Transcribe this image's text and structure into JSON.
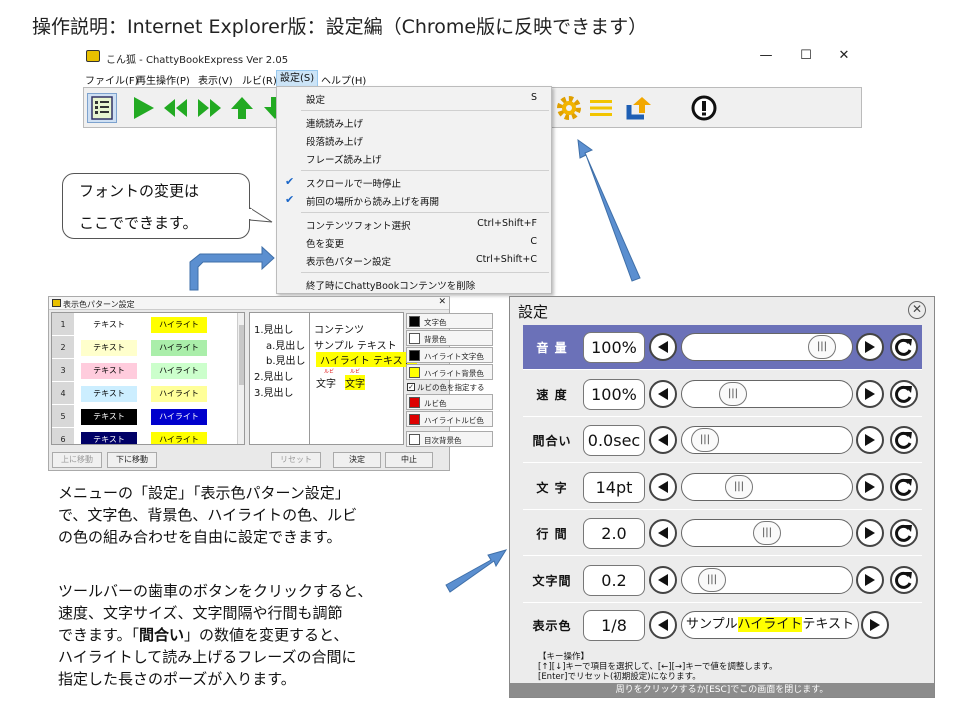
{
  "slide_title": "操作説明：Internet  Explorer版：設定編（Chrome版に反映できます）",
  "window": {
    "title": "こん狐 - ChattyBookExpress Ver 2.05",
    "controls": [
      "—",
      "☐",
      "✕"
    ],
    "menu": [
      "ファイル(F)",
      "再生操作(P)",
      "表示(V)",
      "ルビ(R)",
      "設定(S)",
      "ヘルプ(H)"
    ],
    "active_menu_index": 4
  },
  "toolbar_icons": [
    "list-icon",
    "play-icon",
    "rewind-icon",
    "fast-forward-icon",
    "up-arrow-icon",
    "down-arrow-icon",
    "gear-icon",
    "menu-lines-icon",
    "update-icon",
    "info-icon"
  ],
  "dropdown": {
    "items": [
      {
        "label": "設定",
        "key": "S",
        "checked": false
      },
      {
        "label": "連続読み上げ",
        "key": "",
        "checked": false
      },
      {
        "label": "段落読み上げ",
        "key": "",
        "checked": false
      },
      {
        "label": "フレーズ読み上げ",
        "key": "",
        "checked": false
      },
      {
        "label": "スクロールで一時停止",
        "key": "",
        "checked": true
      },
      {
        "label": "前回の場所から読み上げを再開",
        "key": "",
        "checked": true
      },
      {
        "label": "コンテンツフォント選択",
        "key": "Ctrl+Shift+F",
        "checked": false
      },
      {
        "label": "色を変更",
        "key": "C",
        "checked": false
      },
      {
        "label": "表示色パターン設定",
        "key": "Ctrl+Shift+C",
        "checked": false
      },
      {
        "label": "終了時にChattyBookコンテンツを削除",
        "key": "",
        "checked": false
      }
    ]
  },
  "callout": {
    "line1": "フォントの変更は",
    "line2": "ここでできます。"
  },
  "pattern_dialog": {
    "title": "表示色パターン設定",
    "close": "✕",
    "rows": [
      {
        "num": "1",
        "text": "テキスト",
        "highlight": "ハイライト",
        "text_bg": "#ffffff",
        "text_fg": "#000000",
        "hl_bg": "#ffff00",
        "hl_fg": "#000000"
      },
      {
        "num": "2",
        "text": "テキスト",
        "highlight": "ハイライト",
        "text_bg": "#ffffcc",
        "text_fg": "#000000",
        "hl_bg": "#aaeeaa",
        "hl_fg": "#000000"
      },
      {
        "num": "3",
        "text": "テキスト",
        "highlight": "ハイライト",
        "text_bg": "#ffccdd",
        "text_fg": "#000000",
        "hl_bg": "#ccffcc",
        "hl_fg": "#000000"
      },
      {
        "num": "4",
        "text": "テキスト",
        "highlight": "ハイライト",
        "text_bg": "#cceeff",
        "text_fg": "#000000",
        "hl_bg": "#ffff99",
        "hl_fg": "#000000"
      },
      {
        "num": "5",
        "text": "テキスト",
        "highlight": "ハイライト",
        "text_bg": "#000000",
        "text_fg": "#ffffff",
        "hl_bg": "#0000cc",
        "hl_fg": "#ffffff"
      },
      {
        "num": "6",
        "text": "テキスト",
        "highlight": "ハイライト",
        "text_bg": "#000066",
        "text_fg": "#ffffff",
        "hl_bg": "#ffff00",
        "hl_fg": "#000000"
      }
    ],
    "outline": [
      "1.見出し",
      "a.見出し",
      "b.見出し",
      "2.見出し",
      "3.見出し"
    ],
    "content": {
      "line1": "コンテンツ",
      "line2": "サンプル テキスト",
      "highlight": "ハイライト テキスト",
      "ruby_base": "文字",
      "ruby_top": "ルビ",
      "ruby_base2": "文字",
      "ruby_top2": "ルビ"
    },
    "swatches": [
      {
        "label": "文字色",
        "color": "#000000"
      },
      {
        "label": "背景色",
        "color": "#ffffff"
      },
      {
        "label": "ハイライト文字色",
        "color": "#000000"
      },
      {
        "label": "ハイライト背景色",
        "color": "#ffff00"
      },
      {
        "label": "ルビの色を指定する",
        "color": "checkbox"
      },
      {
        "label": "ルビ色",
        "color": "#dd0000"
      },
      {
        "label": "ハイライトルビ色",
        "color": "#dd0000"
      },
      {
        "label": "目次背景色",
        "color": "#ffffff"
      }
    ],
    "buttons": [
      "上に移動",
      "下に移動",
      "リセット",
      "決定",
      "中止"
    ]
  },
  "para1": [
    "メニューの「設定」「表示色パターン設定」",
    "で、文字色、背景色、ハイライトの色、ルビ",
    "の色の組み合わせを自由に設定できます。"
  ],
  "para2": {
    "line1": "ツールバーの歯車のボタンをクリックすると、",
    "line2": "速度、文字サイズ、文字間隔や行間も調節",
    "line3_pre": "できます。「",
    "line3_bold": "間合い",
    "line3_post": "」の数値を変更すると、",
    "line4": "ハイライトして読み上げるフレーズの合間に",
    "line5": "指定した長さのポーズが入ります。"
  },
  "settings_dialog": {
    "title": "設定",
    "close": "✕",
    "rows": [
      {
        "label": "音 量",
        "value": "100%",
        "slider": 0.9,
        "selected": true
      },
      {
        "label": "速 度",
        "value": "100%",
        "slider": 0.25,
        "selected": false
      },
      {
        "label": "間合い",
        "value": "0.0sec",
        "slider": 0.05,
        "selected": false
      },
      {
        "label": "文 字",
        "value": "14pt",
        "slider": 0.3,
        "selected": false
      },
      {
        "label": "行 間",
        "value": "2.0",
        "slider": 0.5,
        "selected": false
      },
      {
        "label": "文字間",
        "value": "0.2",
        "slider": 0.1,
        "selected": false
      }
    ],
    "color_row": {
      "label": "表示色",
      "value": "1/8",
      "sample_pre": "サンプル",
      "sample_hl": "ハイライト",
      "sample_post": "テキスト"
    },
    "thumb_glyph": "|||",
    "help_title": "【キー操作】",
    "help_line1": "[↑][↓]キーで項目を選択して、[←][→]キーで値を調整します。",
    "help_line2": "[Enter]でリセット(初期設定)になります。",
    "footer": "周りをクリックするか[ESC]でこの画面を閉じます。"
  }
}
